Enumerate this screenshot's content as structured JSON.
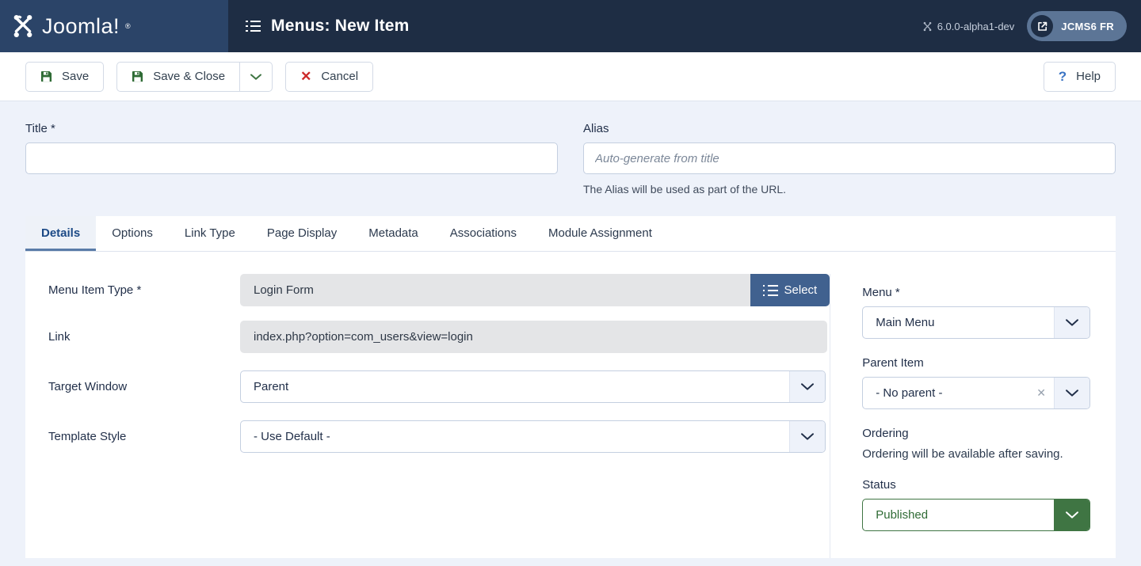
{
  "header": {
    "brand": "Joomla!",
    "brand_icon": "joomla-logo-icon",
    "title": "Menus: New Item",
    "title_icon": "list-icon",
    "version": "6.0.0-alpha1-dev",
    "version_icon": "joomla-mini-icon",
    "site_button_label": "JCMS6 FR",
    "site_button_icon": "external-link-icon"
  },
  "toolbar": {
    "save_label": "Save",
    "save_icon": "floppy-disk-icon",
    "save_close_label": "Save & Close",
    "save_close_icon": "floppy-disk-icon",
    "dropdown_icon": "chevron-down-icon",
    "cancel_label": "Cancel",
    "cancel_icon": "x-icon",
    "help_label": "Help",
    "help_icon": "question-mark-icon"
  },
  "form": {
    "title": {
      "label": "Title *",
      "value": "",
      "placeholder": ""
    },
    "alias": {
      "label": "Alias",
      "value": "",
      "placeholder": "Auto-generate from title",
      "help": "The Alias will be used as part of the URL."
    }
  },
  "tabs": [
    {
      "label": "Details",
      "active": true
    },
    {
      "label": "Options",
      "active": false
    },
    {
      "label": "Link Type",
      "active": false
    },
    {
      "label": "Page Display",
      "active": false
    },
    {
      "label": "Metadata",
      "active": false
    },
    {
      "label": "Associations",
      "active": false
    },
    {
      "label": "Module Assignment",
      "active": false
    }
  ],
  "details": {
    "menu_item_type": {
      "label": "Menu Item Type *",
      "value": "Login Form",
      "select_label": "Select",
      "select_icon": "list-icon"
    },
    "link": {
      "label": "Link",
      "value": "index.php?option=com_users&view=login"
    },
    "target_window": {
      "label": "Target Window",
      "value": "Parent",
      "arrow_icon": "chevron-down-icon"
    },
    "template_style": {
      "label": "Template Style",
      "value": "- Use Default -",
      "arrow_icon": "chevron-down-icon"
    }
  },
  "sidebar": {
    "menu": {
      "label": "Menu *",
      "value": "Main Menu",
      "arrow_icon": "chevron-down-icon"
    },
    "parent_item": {
      "label": "Parent Item",
      "value": "- No parent -",
      "clear_icon": "clear-x-icon",
      "arrow_icon": "chevron-down-icon"
    },
    "ordering": {
      "label": "Ordering",
      "note": "Ordering will be available after saving."
    },
    "status": {
      "label": "Status",
      "value": "Published",
      "arrow_icon": "chevron-down-icon"
    }
  },
  "colors": {
    "brand_dark": "#1e2d44",
    "brand_mid": "#2b4468",
    "accent_blue": "#40618f",
    "status_green": "#3f7543",
    "danger_red": "#cc2a2a",
    "page_bg": "#eef2fa"
  }
}
